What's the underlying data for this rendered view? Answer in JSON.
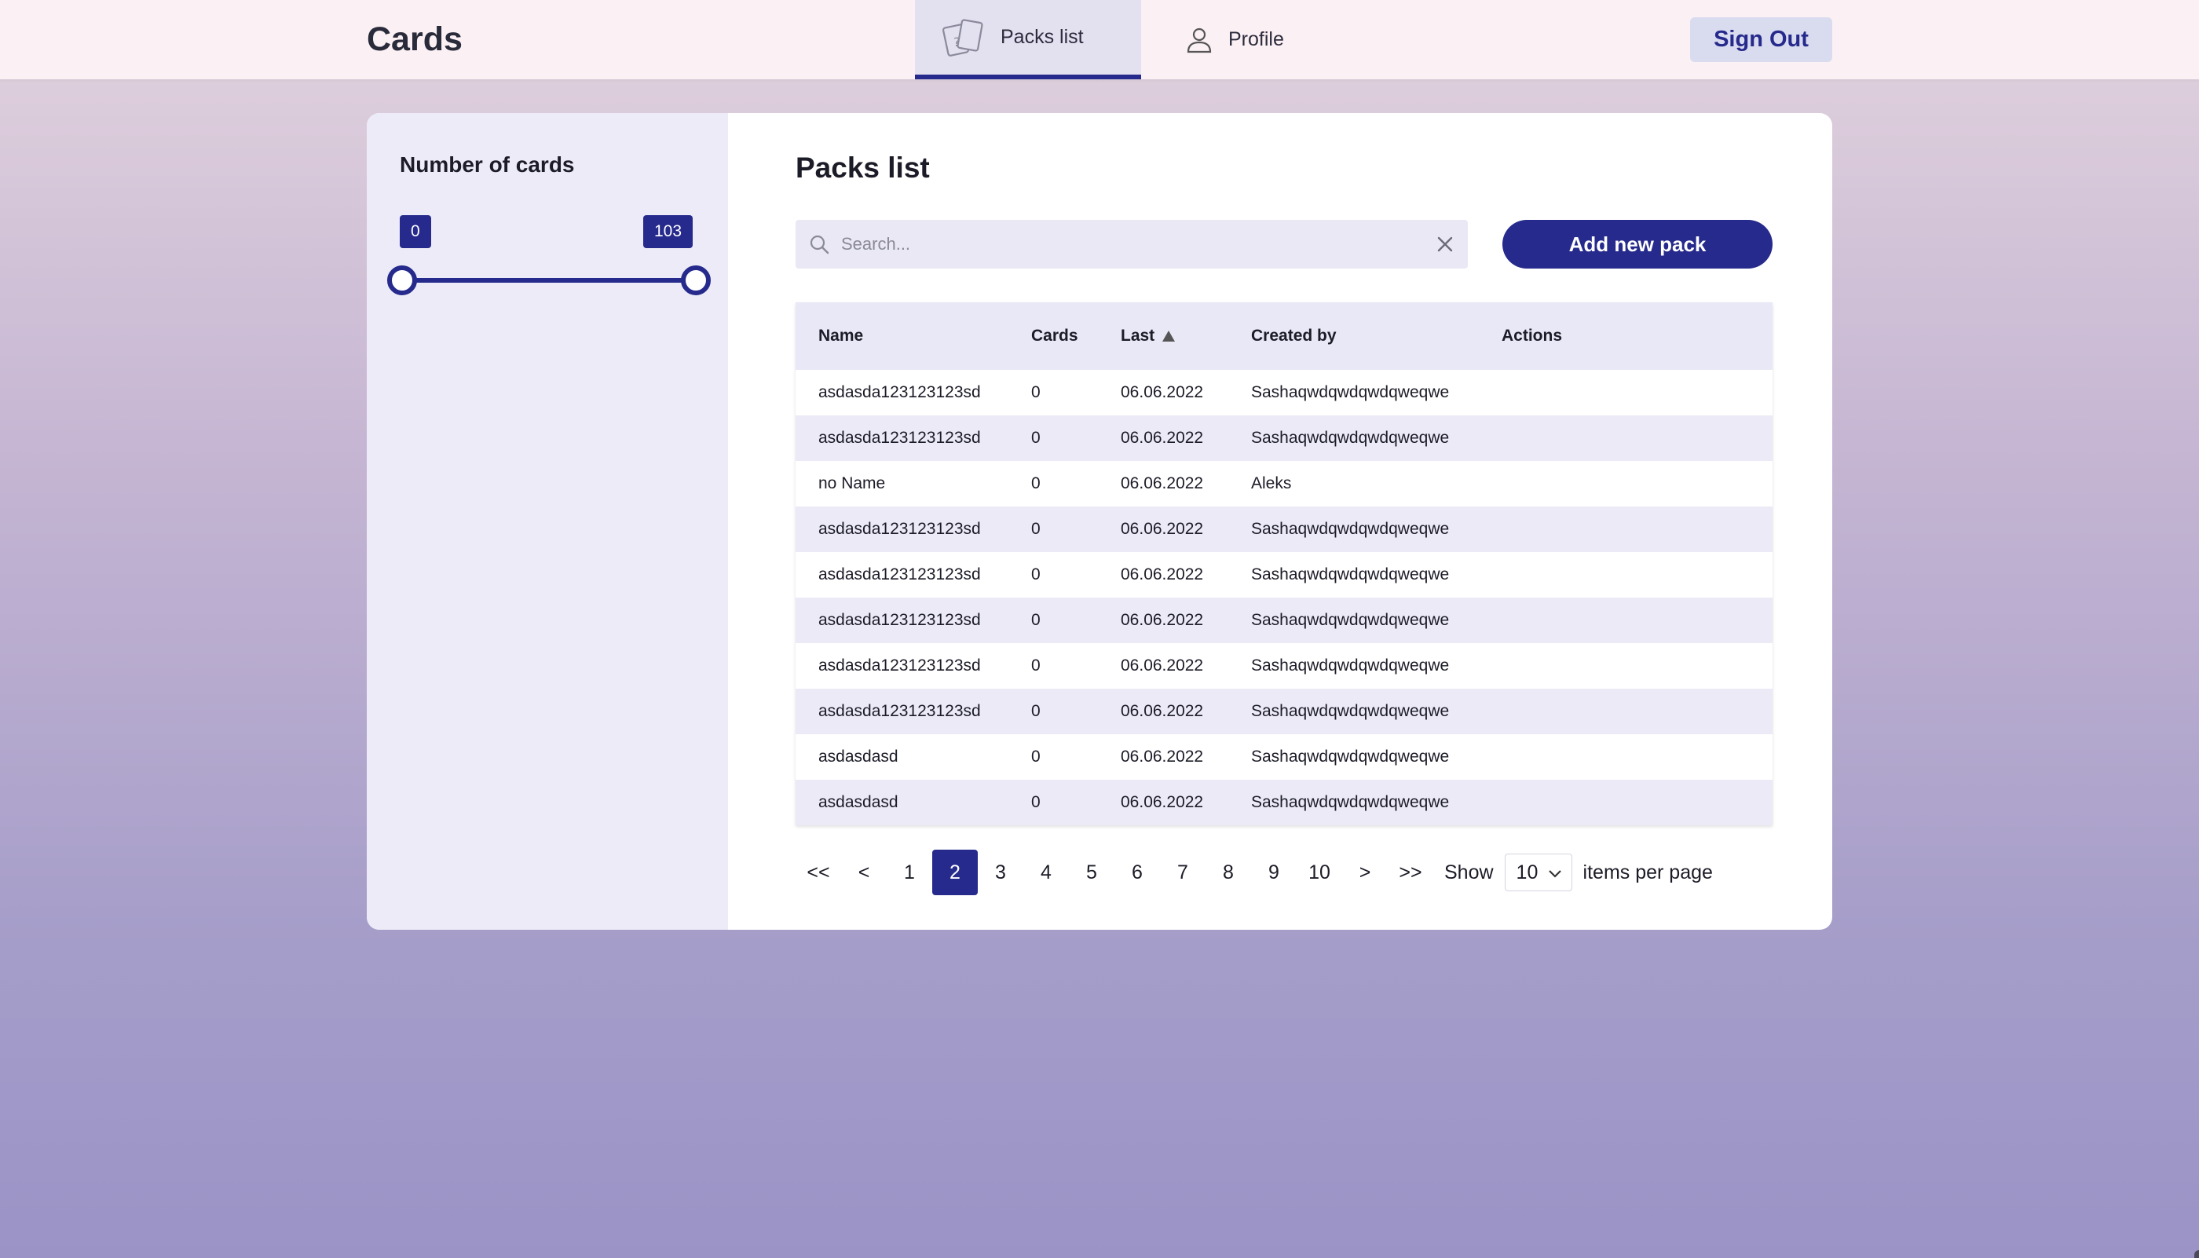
{
  "header": {
    "brand": "Cards",
    "tabs": [
      {
        "label": "Packs list",
        "icon": "cards-icon",
        "active": true
      },
      {
        "label": "Profile",
        "icon": "user-icon",
        "active": false
      }
    ],
    "sign_out_label": "Sign Out"
  },
  "sidebar": {
    "title": "Number of cards",
    "range": {
      "min": "0",
      "max": "103"
    }
  },
  "main": {
    "title": "Packs list",
    "search": {
      "placeholder": "Search...",
      "value": ""
    },
    "add_button_label": "Add new pack",
    "table": {
      "columns": [
        "Name",
        "Cards",
        "Last",
        "Created by",
        "Actions"
      ],
      "sort": {
        "column": "Last",
        "direction": "ascending"
      },
      "rows": [
        {
          "name": "asdasda123123123sd",
          "cards": "0",
          "last": "06.06.2022",
          "created_by": "Sashaqwdqwdqwdqweqwe",
          "actions": ""
        },
        {
          "name": "asdasda123123123sd",
          "cards": "0",
          "last": "06.06.2022",
          "created_by": "Sashaqwdqwdqwdqweqwe",
          "actions": ""
        },
        {
          "name": "no Name",
          "cards": "0",
          "last": "06.06.2022",
          "created_by": "Aleks",
          "actions": ""
        },
        {
          "name": "asdasda123123123sd",
          "cards": "0",
          "last": "06.06.2022",
          "created_by": "Sashaqwdqwdqwdqweqwe",
          "actions": ""
        },
        {
          "name": "asdasda123123123sd",
          "cards": "0",
          "last": "06.06.2022",
          "created_by": "Sashaqwdqwdqwdqweqwe",
          "actions": ""
        },
        {
          "name": "asdasda123123123sd",
          "cards": "0",
          "last": "06.06.2022",
          "created_by": "Sashaqwdqwdqwdqweqwe",
          "actions": ""
        },
        {
          "name": "asdasda123123123sd",
          "cards": "0",
          "last": "06.06.2022",
          "created_by": "Sashaqwdqwdqwdqweqwe",
          "actions": ""
        },
        {
          "name": "asdasda123123123sd",
          "cards": "0",
          "last": "06.06.2022",
          "created_by": "Sashaqwdqwdqwdqweqwe",
          "actions": ""
        },
        {
          "name": "asdasdasd",
          "cards": "0",
          "last": "06.06.2022",
          "created_by": "Sashaqwdqwdqwdqweqwe",
          "actions": ""
        },
        {
          "name": "asdasdasd",
          "cards": "0",
          "last": "06.06.2022",
          "created_by": "Sashaqwdqwdqwdqweqwe",
          "actions": ""
        }
      ]
    },
    "pagination": {
      "first": "<<",
      "prev": "<",
      "pages": [
        "1",
        "2",
        "3",
        "4",
        "5",
        "6",
        "7",
        "8",
        "9",
        "10"
      ],
      "current": "2",
      "next": ">",
      "last": ">>",
      "show_label": "Show",
      "per_page": "10",
      "per_page_suffix": "items per page"
    }
  },
  "colors": {
    "accent": "#262a8c",
    "topbar": "#fbf0f4",
    "sidebar": "#ecebf7",
    "row_alt": "#ebeaf6"
  }
}
